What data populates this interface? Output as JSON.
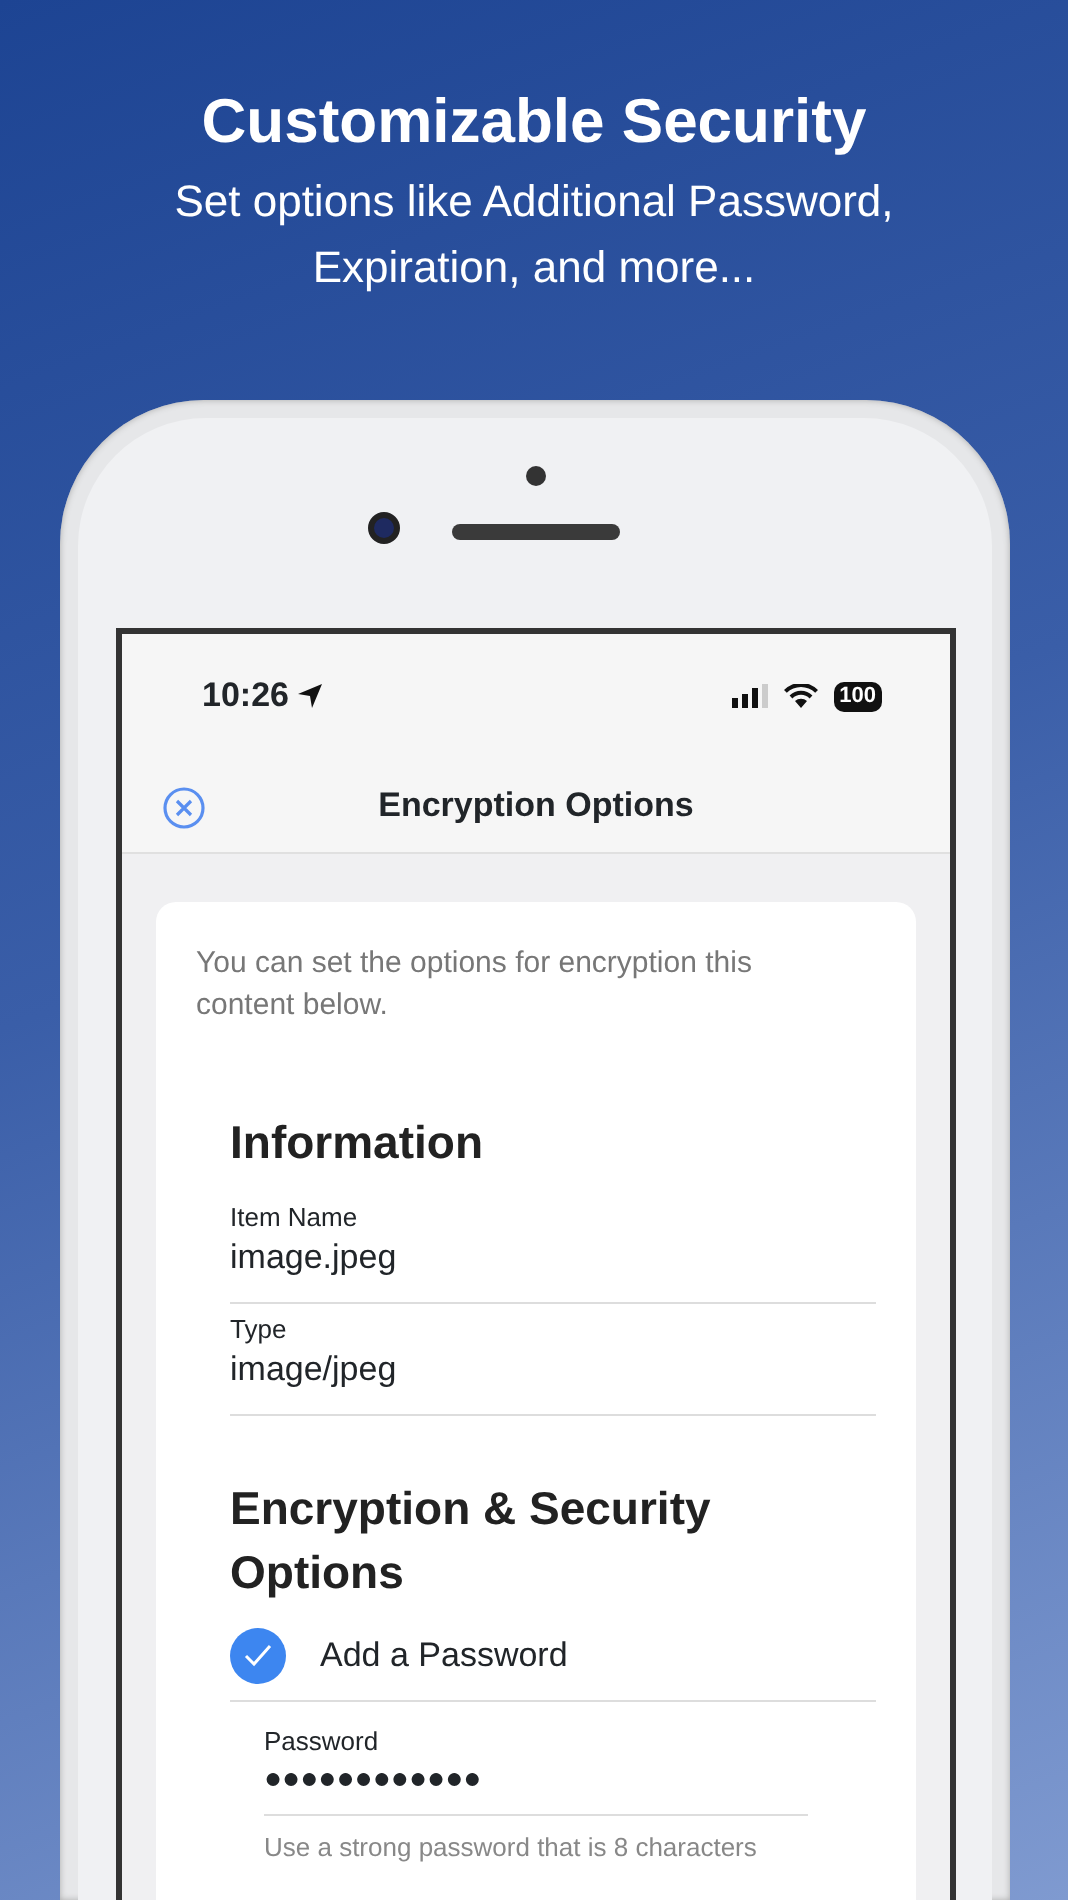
{
  "headline": {
    "title": "Customizable Security",
    "subtitle": "Set options like Additional Password, Expiration, and more..."
  },
  "status_bar": {
    "time": "10:26",
    "battery": "100"
  },
  "nav": {
    "title": "Encryption Options"
  },
  "intro": "You can set the options for encryption this content below.",
  "sections": [
    {
      "title": "Information",
      "fields": [
        {
          "label": "Item Name",
          "value": "image.jpeg"
        },
        {
          "label": "Type",
          "value": "image/jpeg"
        }
      ]
    },
    {
      "title": "Encryption & Security Options",
      "options": [
        {
          "label": "Add a Password",
          "checked": true
        }
      ]
    }
  ],
  "password": {
    "label": "Password",
    "value": "●●●●●●●●●●●●",
    "hint": "Use a strong password that is 8 characters"
  }
}
